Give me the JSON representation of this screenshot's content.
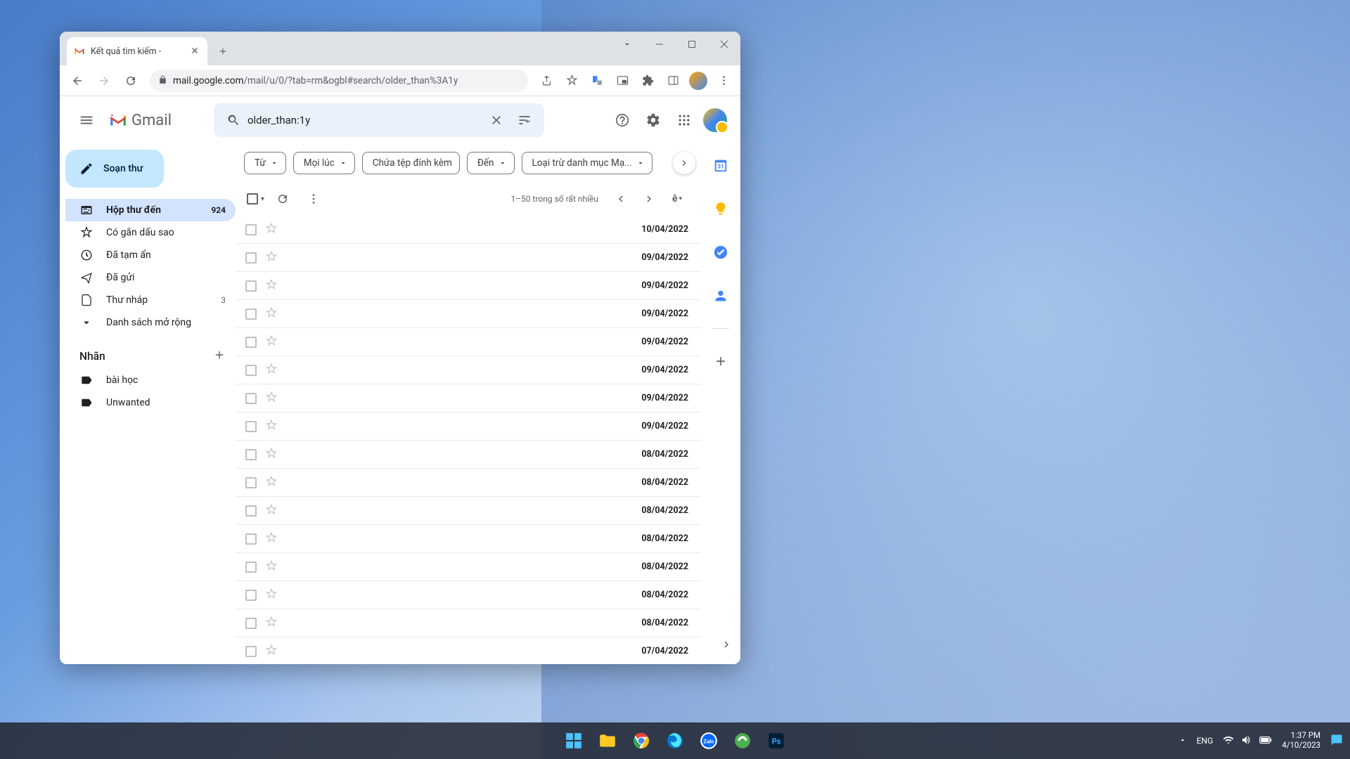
{
  "browser": {
    "tab_title": "Kết quả tìm kiếm -",
    "url_domain": "mail.google.com",
    "url_path": "/mail/u/0/?tab=rm&ogbl#search/older_than%3A1y"
  },
  "gmail": {
    "logo_text": "Gmail",
    "search_value": "older_than:1y",
    "compose_label": "Soạn thư",
    "nav": [
      {
        "label": "Hộp thư đến",
        "count": "924",
        "active": true
      },
      {
        "label": "Có gắn dấu sao"
      },
      {
        "label": "Đã tạm ẩn"
      },
      {
        "label": "Đã gửi"
      },
      {
        "label": "Thư nháp",
        "count": "3"
      },
      {
        "label": "Danh sách mở rộng"
      }
    ],
    "labels_header": "Nhãn",
    "labels": [
      {
        "label": "bài học"
      },
      {
        "label": "Unwanted"
      }
    ],
    "filters": [
      "Từ",
      "Mọi lúc",
      "Chứa tệp đính kèm",
      "Đến",
      "Loại trừ danh mục Mạ..."
    ],
    "page_info": "1–50 trong số rất nhiều",
    "emails": [
      {
        "date": "10/04/2022"
      },
      {
        "date": "09/04/2022"
      },
      {
        "date": "09/04/2022"
      },
      {
        "date": "09/04/2022"
      },
      {
        "date": "09/04/2022"
      },
      {
        "date": "09/04/2022"
      },
      {
        "date": "09/04/2022"
      },
      {
        "date": "09/04/2022"
      },
      {
        "date": "08/04/2022"
      },
      {
        "date": "08/04/2022"
      },
      {
        "date": "08/04/2022"
      },
      {
        "date": "08/04/2022"
      },
      {
        "date": "08/04/2022"
      },
      {
        "date": "08/04/2022"
      },
      {
        "date": "08/04/2022"
      },
      {
        "date": "07/04/2022"
      }
    ]
  },
  "taskbar": {
    "lang": "ENG",
    "time": "1:37 PM",
    "date": "4/10/2023"
  }
}
